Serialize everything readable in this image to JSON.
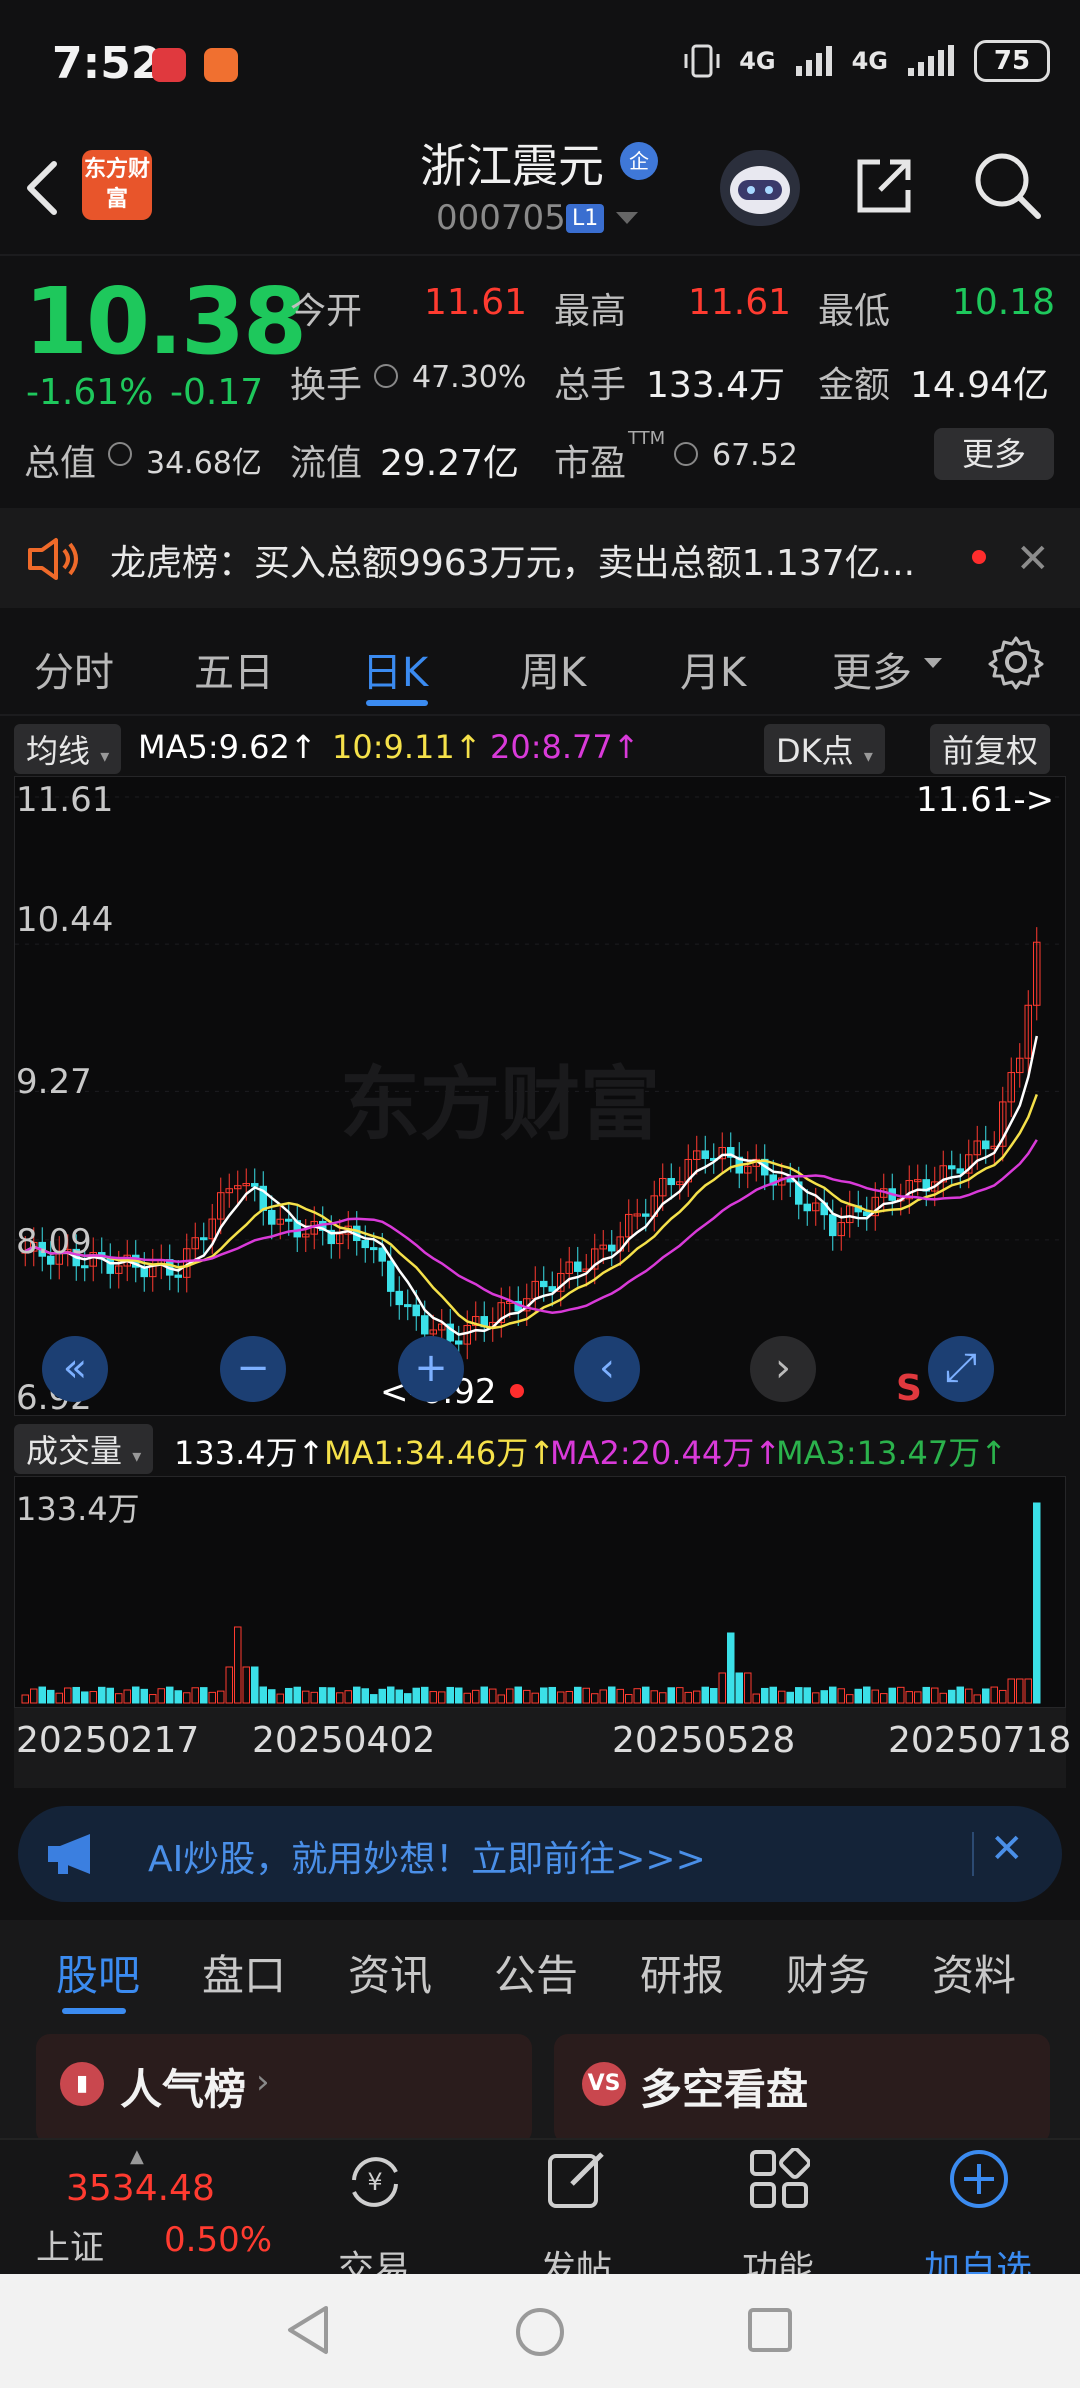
{
  "status_bar": {
    "time": "7:52",
    "network1": "4G",
    "network2": "4G",
    "battery": "75"
  },
  "header": {
    "logo_text": "东方财富",
    "stock_name": "浙江震元",
    "badge": "企",
    "code": "000705",
    "level": "L1"
  },
  "quote": {
    "price": "10.38",
    "change_pct": "-1.61%",
    "change": "-0.17",
    "open_label": "今开",
    "open": "11.61",
    "high_label": "最高",
    "high": "11.61",
    "low_label": "最低",
    "low": "10.18",
    "turnover_label": "换手",
    "turnover": "47.30%",
    "volume_label": "总手",
    "volume": "133.4万",
    "amount_label": "金额",
    "amount": "14.94亿",
    "mktcap_label": "总值",
    "mktcap": "34.68亿",
    "float_label": "流值",
    "float": "29.27亿",
    "pe_label": "市盈",
    "pe_sup": "TTM",
    "pe": "67.52",
    "more_label": "更多"
  },
  "dragon_tiger": {
    "text": "龙虎榜：买入总额9963万元，卖出总额1.137亿..."
  },
  "period_tabs": [
    "分时",
    "五日",
    "日K",
    "周K",
    "月K",
    "更多"
  ],
  "active_period": "日K",
  "ma_bar": {
    "chip": "均线",
    "ma5": "MA5:9.62",
    "ma10": "10:9.11",
    "ma20": "20:8.77",
    "dk": "DK点",
    "fq": "前复权"
  },
  "price_axis": [
    "11.61",
    "10.44",
    "9.27",
    "8.09",
    "6.92"
  ],
  "chart_marks": {
    "high_marker": "11.61->",
    "low_marker": "<-6.92",
    "s_marker": "S"
  },
  "volume_bar": {
    "chip": "成交量",
    "vol": "133.4万",
    "ma1": "MA1:34.46万",
    "ma2": "MA2:20.44万",
    "ma3": "MA3:13.47万"
  },
  "volume_axis_top": "133.4万",
  "dates": [
    "20250217",
    "20250402",
    "20250528",
    "20250718"
  ],
  "ai_banner": {
    "text": "AI炒股，就用妙想！立即前往>>>"
  },
  "bottom_tabs": [
    "股吧",
    "盘口",
    "资讯",
    "公告",
    "研报",
    "财务",
    "资料"
  ],
  "cards": [
    {
      "icon": "ili",
      "title": "人气榜"
    },
    {
      "icon": "VS",
      "title": "多空看盘"
    }
  ],
  "bottom_nav": {
    "index_value": "3534.48",
    "index_name": "上证",
    "index_pct": "0.50%",
    "trade": "交易",
    "post": "发帖",
    "func": "功能",
    "add": "加自选"
  },
  "colors": {
    "up": "#ff3b30",
    "down": "#1ec85c",
    "accent": "#3b8bf0",
    "ma5": "#ffffff",
    "ma10": "#f5e14a",
    "ma20": "#d93ad9",
    "vol_latest": "#3be0e8"
  }
}
